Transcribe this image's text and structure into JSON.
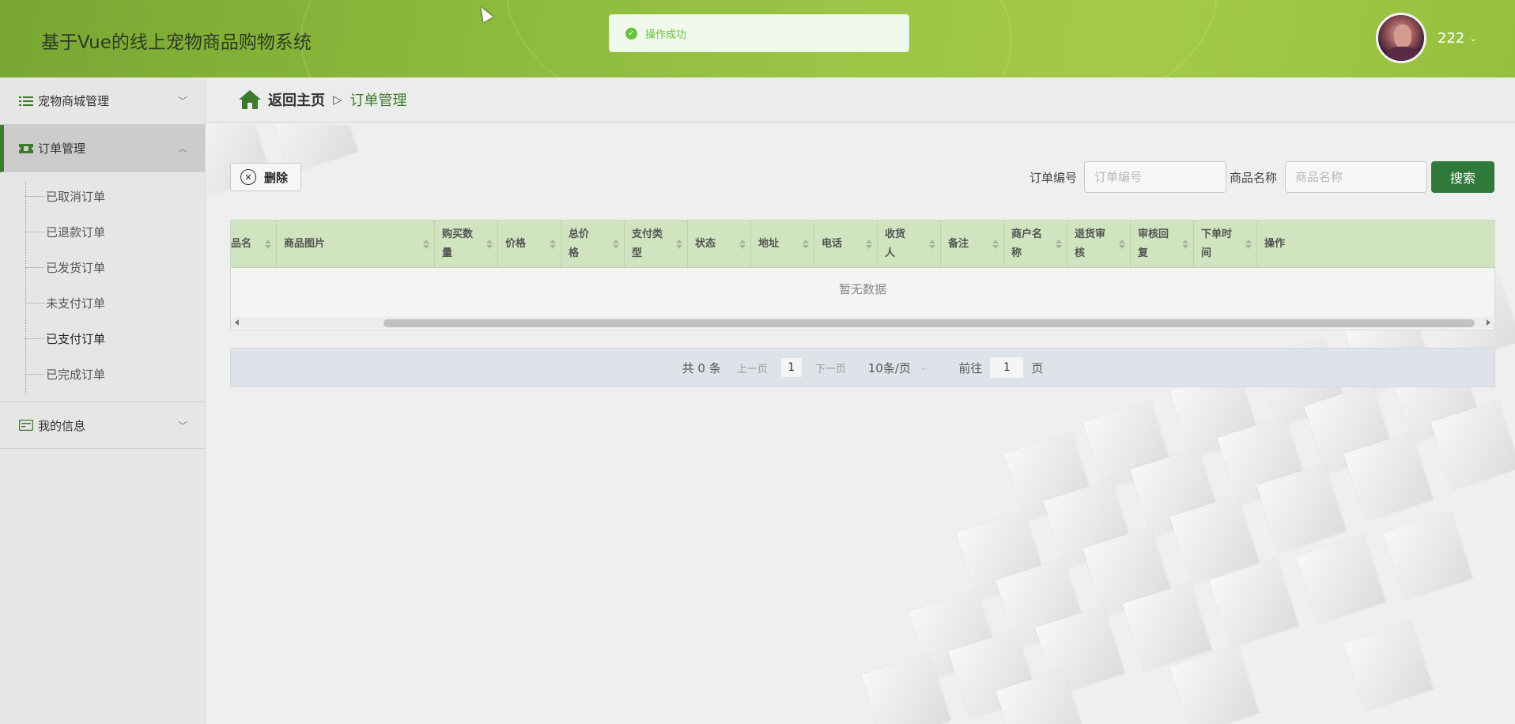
{
  "app": {
    "title": "基于Vue的线上宠物商品购物系统"
  },
  "toast": {
    "message": "操作成功"
  },
  "user": {
    "name": "222"
  },
  "sidebar": {
    "items": [
      {
        "label": "宠物商城管理"
      },
      {
        "label": "订单管理"
      },
      {
        "label": "我的信息"
      }
    ],
    "subitems": [
      {
        "label": "已取消订单"
      },
      {
        "label": "已退款订单"
      },
      {
        "label": "已发货订单"
      },
      {
        "label": "未支付订单"
      },
      {
        "label": "已支付订单"
      },
      {
        "label": "已完成订单"
      }
    ]
  },
  "breadcrumb": {
    "home": "返回主页",
    "separator": "▷",
    "current": "订单管理"
  },
  "toolbar": {
    "delete_label": "删除",
    "search_label": "搜索"
  },
  "search": {
    "order_no_label": "订单编号",
    "order_no_placeholder": "订单编号",
    "product_label": "商品名称",
    "product_placeholder": "商品名称"
  },
  "table": {
    "columns": [
      {
        "label": "品名"
      },
      {
        "label": "商品图片"
      },
      {
        "label": "购买数量"
      },
      {
        "label": "价格"
      },
      {
        "label": "总价格"
      },
      {
        "label": "支付类型"
      },
      {
        "label": "状态"
      },
      {
        "label": "地址"
      },
      {
        "label": "电话"
      },
      {
        "label": "收货人"
      },
      {
        "label": "备注"
      },
      {
        "label": "商户名称"
      },
      {
        "label": "退货审核"
      },
      {
        "label": "审核回复"
      },
      {
        "label": "下单时间"
      },
      {
        "label": "操作"
      }
    ],
    "empty_text": "暂无数据"
  },
  "pagination": {
    "total": "共 0 条",
    "prev": "上一页",
    "page": "1",
    "next": "下一页",
    "page_size": "10条/页",
    "goto_label": "前往",
    "goto_value": "1",
    "goto_suffix": "页"
  },
  "colors": {
    "header_green": "#8ab93c",
    "accent_dark_green": "#2f7a3b",
    "table_header": "#cfe4bf",
    "toast_green": "#67c23a"
  }
}
